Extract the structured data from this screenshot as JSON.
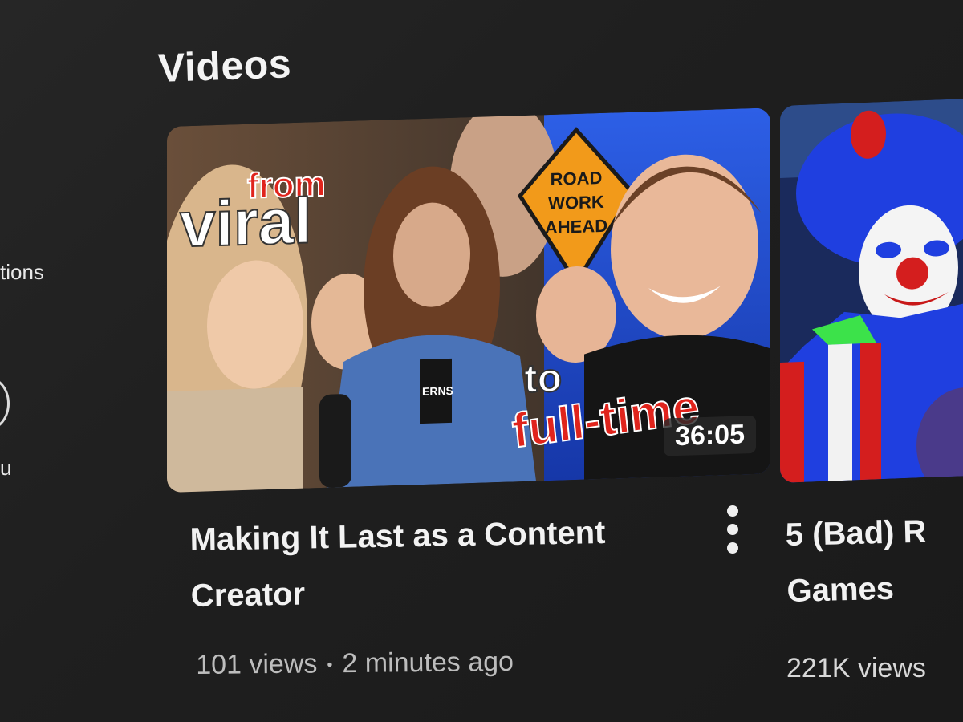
{
  "sidebar": {
    "fragment_1": "tions",
    "fragment_2": "u"
  },
  "section": {
    "title": "Videos"
  },
  "videos": [
    {
      "title": "Making It Last as a Content Creator",
      "views": "101 views",
      "separator": "•",
      "age": "2 minutes ago",
      "duration": "36:05",
      "thumbnail_text": {
        "line1": "from",
        "line2": "viral",
        "line3": "to",
        "line4": "full-time",
        "sign": [
          "ROAD",
          "WORK",
          "AHEAD"
        ],
        "shirt": "ERNS"
      }
    },
    {
      "title": "5 (Bad) R Games",
      "title_line1": "5 (Bad) R",
      "title_line2": "Games",
      "views": "221K views"
    }
  ],
  "colors": {
    "background": "#1c1c1c",
    "text_primary": "#f1f1f1",
    "text_secondary": "#bdbdbd",
    "thumb_red": "#e0241c",
    "thumb_sign_orange": "#f29a1a",
    "thumb_blue": "#1f4fd8"
  },
  "icons": {
    "more": "more-vert-icon",
    "sidebar": "circle-icon"
  }
}
